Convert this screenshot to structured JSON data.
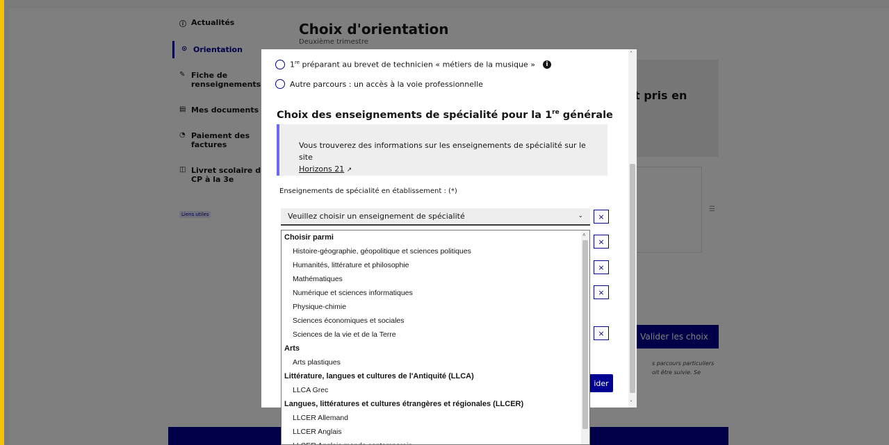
{
  "sidebar": {
    "items": [
      {
        "label": "Actualités",
        "icon": "info-icon"
      },
      {
        "label": "Orientation",
        "icon": "compass-icon"
      },
      {
        "label": "Fiche de renseignements",
        "icon": "edit-icon"
      },
      {
        "label": "Mes documents",
        "icon": "document-icon"
      },
      {
        "label": "Paiement des factures",
        "icon": "payment-icon"
      },
      {
        "label": "Livret scolaire du CP à la 3e",
        "icon": "book-icon"
      }
    ],
    "useful_links": "Liens utiles"
  },
  "page": {
    "title": "Choix d'orientation",
    "subtitle": "Deuxième trimestre",
    "card_text": "t pris en",
    "validate_button": "Valider les choix",
    "italic_line1": "s parcours particuliers",
    "italic_line2": "oit être suivie. Se"
  },
  "modal": {
    "radio_options": [
      "1re préparant au brevet de technicien « métiers de la musique »",
      "Autre parcours : un accès à la voie professionnelle"
    ],
    "section_heading": "Choix des enseignements de spécialité pour la 1re générale",
    "section_heading_main": "Choix des enseignements de spécialité pour la 1",
    "section_heading_sup": "re",
    "section_heading_end": " générale",
    "callout_text": "Vous trouverez des informations sur les enseignements de spécialité sur le site",
    "callout_link": "Horizons 21",
    "field_label": "Enseignements de spécialité en établissement : (*)",
    "select_placeholder": "Veuillez choisir un enseignement de spécialité",
    "remove_symbol": "×",
    "validate_partial": "ider"
  },
  "dropdown": {
    "groups": [
      {
        "label": "Choisir parmi",
        "options": [
          "Histoire-géographie, géopolitique et sciences politiques",
          "Humanités, littérature et philosophie",
          "Mathématiques",
          "Numérique et sciences informatiques",
          "Physique-chimie",
          "Sciences économiques et sociales",
          "Sciences de la vie et de la Terre"
        ]
      },
      {
        "label": "Arts",
        "options": [
          "Arts plastiques"
        ]
      },
      {
        "label": "Littérature, langues et cultures de l'Antiquité (LLCA)",
        "options": [
          "LLCA Grec"
        ]
      },
      {
        "label": "Langues, littératures et cultures étrangères et régionales (LLCER)",
        "options": [
          "LLCER Allemand",
          "LLCER Anglais",
          "LLCER Anglais monde contemporain"
        ]
      }
    ]
  },
  "colors": {
    "accent_yellow": "#f6c100",
    "primary_blue": "#000091",
    "callout_border": "#6a6af4"
  }
}
